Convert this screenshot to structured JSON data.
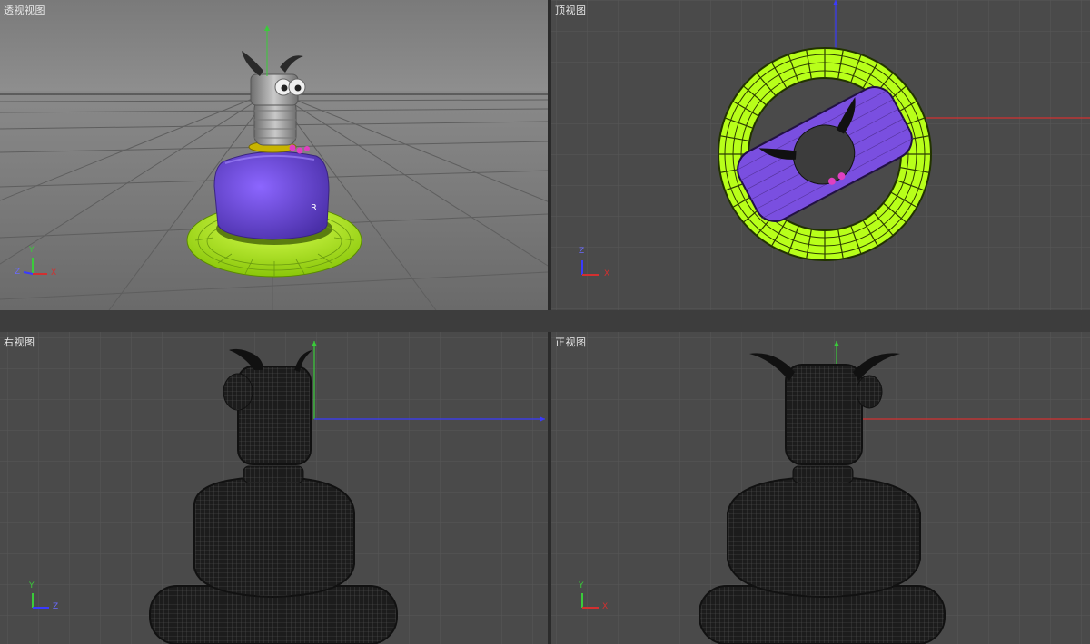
{
  "viewports": {
    "perspective": {
      "title": "透视视图",
      "axis": {
        "y": "Y",
        "z": "Z",
        "x": "X"
      }
    },
    "top": {
      "title": "顶视图",
      "axis": {
        "z": "Z",
        "x": "X"
      }
    },
    "right": {
      "title": "右视图",
      "axis": {
        "y": "Y",
        "z": "Z"
      }
    },
    "front": {
      "title": "正视图",
      "axis": {
        "y": "Y",
        "x": "X"
      }
    }
  },
  "colors": {
    "viewport_bg": "#4a4a4a",
    "grid": "#585858",
    "ring_lime": "#b8ff1a",
    "body_purple": "#7a4fe0",
    "head_grey": "#9a9a9a",
    "axis_red": "#d23030",
    "axis_green": "#3acb3a",
    "axis_blue": "#3a3aff"
  },
  "icons": [
    "axis-gizmo-icon",
    "camera-axis-icon"
  ]
}
